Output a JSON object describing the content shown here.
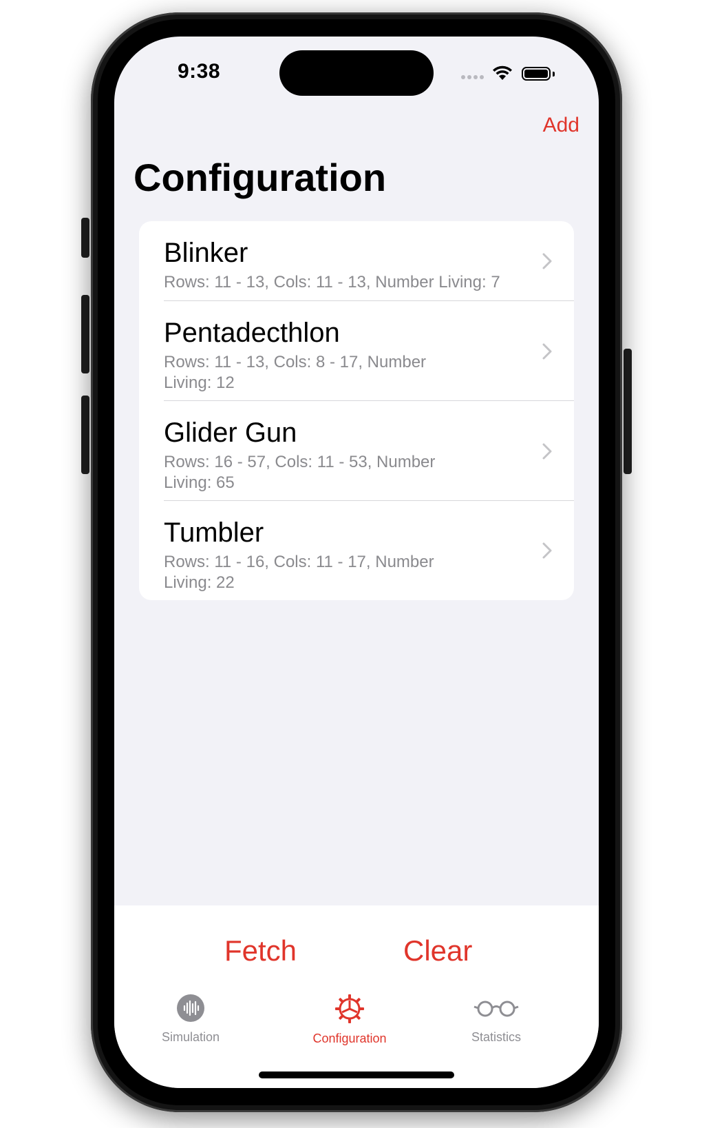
{
  "status_bar": {
    "time": "9:38"
  },
  "nav": {
    "add_label": "Add",
    "title": "Configuration"
  },
  "configurations": [
    {
      "name": "Blinker",
      "detail": "Rows: 11 - 13, Cols: 11 - 13, Number Living: 7"
    },
    {
      "name": "Pentadecthlon",
      "detail_line1": "Rows: 11 - 13, Cols: 8 - 17, Number",
      "detail_line2": "Living: 12"
    },
    {
      "name": "Glider Gun",
      "detail_line1": "Rows: 16 - 57, Cols: 11 - 53, Number",
      "detail_line2": "Living: 65"
    },
    {
      "name": "Tumbler",
      "detail_line1": "Rows: 11 - 16, Cols: 11 - 17, Number",
      "detail_line2": "Living: 22"
    }
  ],
  "actions": {
    "fetch_label": "Fetch",
    "clear_label": "Clear"
  },
  "tabs": [
    {
      "label": "Simulation",
      "icon": "waveform-icon",
      "active": false
    },
    {
      "label": "Configuration",
      "icon": "gear-icon",
      "active": true
    },
    {
      "label": "Statistics",
      "icon": "glasses-icon",
      "active": false
    }
  ],
  "colors": {
    "accent": "#e0352b",
    "background": "#f2f2f7",
    "secondary_text": "#8a8a8e",
    "inactive_tab": "#8e8e93"
  }
}
